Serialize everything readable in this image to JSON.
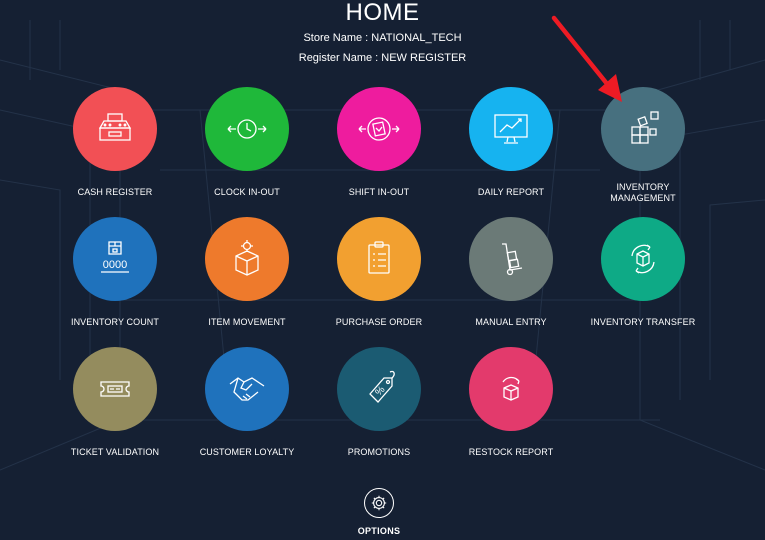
{
  "header": {
    "title": "HOME",
    "store_name": "Store Name : NATIONAL_TECH",
    "register_name": "Register Name : NEW REGISTER"
  },
  "tiles": [
    {
      "label": "CASH REGISTER",
      "color": "#f25055",
      "icon": "cash-register-icon"
    },
    {
      "label": "CLOCK IN-OUT",
      "color": "#1fb83a",
      "icon": "clock-icon"
    },
    {
      "label": "SHIFT IN-OUT",
      "color": "#ee1c9e",
      "icon": "shift-icon"
    },
    {
      "label": "DAILY REPORT",
      "color": "#16b3f0",
      "icon": "monitor-chart-icon"
    },
    {
      "label": "INVENTORY MANAGEMENT",
      "color": "#47707f",
      "icon": "inventory-boxes-icon"
    },
    {
      "label": "INVENTORY COUNT",
      "color": "#1f72bc",
      "icon": "inventory-count-icon"
    },
    {
      "label": "ITEM MOVEMENT",
      "color": "#ee7a2c",
      "icon": "box-gear-icon"
    },
    {
      "label": "PURCHASE ORDER",
      "color": "#f2a030",
      "icon": "clipboard-icon"
    },
    {
      "label": "MANUAL ENTRY",
      "color": "#6b7a77",
      "icon": "hand-truck-icon"
    },
    {
      "label": "INVENTORY TRANSFER",
      "color": "#0eaa86",
      "icon": "box-transfer-icon"
    },
    {
      "label": "TICKET VALIDATION",
      "color": "#948c5e",
      "icon": "ticket-icon"
    },
    {
      "label": "CUSTOMER LOYALTY",
      "color": "#1f72bc",
      "icon": "handshake-icon"
    },
    {
      "label": "PROMOTIONS",
      "color": "#1b5b72",
      "icon": "price-tag-icon"
    },
    {
      "label": "RESTOCK REPORT",
      "color": "#e33a6c",
      "icon": "restock-box-icon"
    }
  ],
  "options": {
    "label": "OPTIONS",
    "icon": "gear-icon"
  },
  "annotation": {
    "color": "#ee1b24",
    "icon": "red-arrow-icon"
  }
}
